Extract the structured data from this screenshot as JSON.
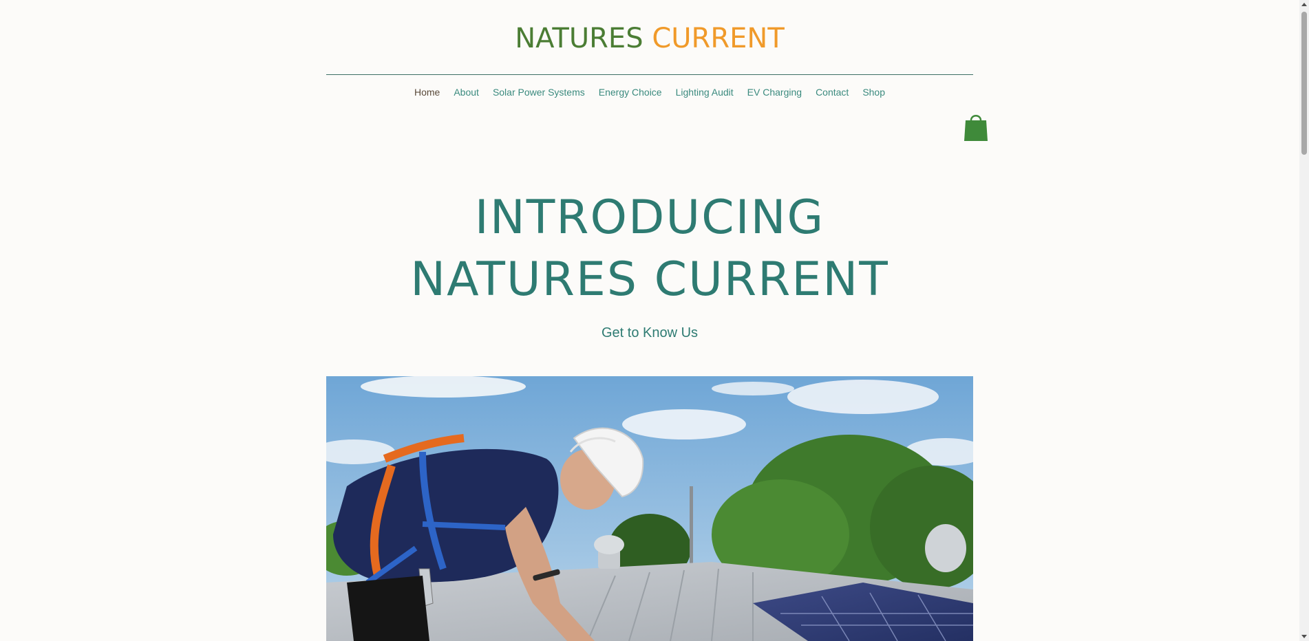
{
  "brand": {
    "word1": "NATURES",
    "word2": "CURRENT",
    "color1": "#4b7d34",
    "color2": "#f09a2a"
  },
  "nav": {
    "items": [
      "Home",
      "About",
      "Solar Power Systems",
      "Energy Choice",
      "Lighting Audit",
      "EV Charging",
      "Contact",
      "Shop"
    ],
    "active": "Home"
  },
  "cart": {
    "icon": "shopping-bag-icon",
    "color": "#3f8a3a"
  },
  "hero": {
    "title_line1": "INTRODUCING",
    "title_line2": "NATURES CURRENT",
    "subtitle": "Get to Know Us",
    "image": "solar-installer-photo"
  },
  "colors": {
    "accent": "#2e7b72",
    "background": "#fcfbf9"
  }
}
